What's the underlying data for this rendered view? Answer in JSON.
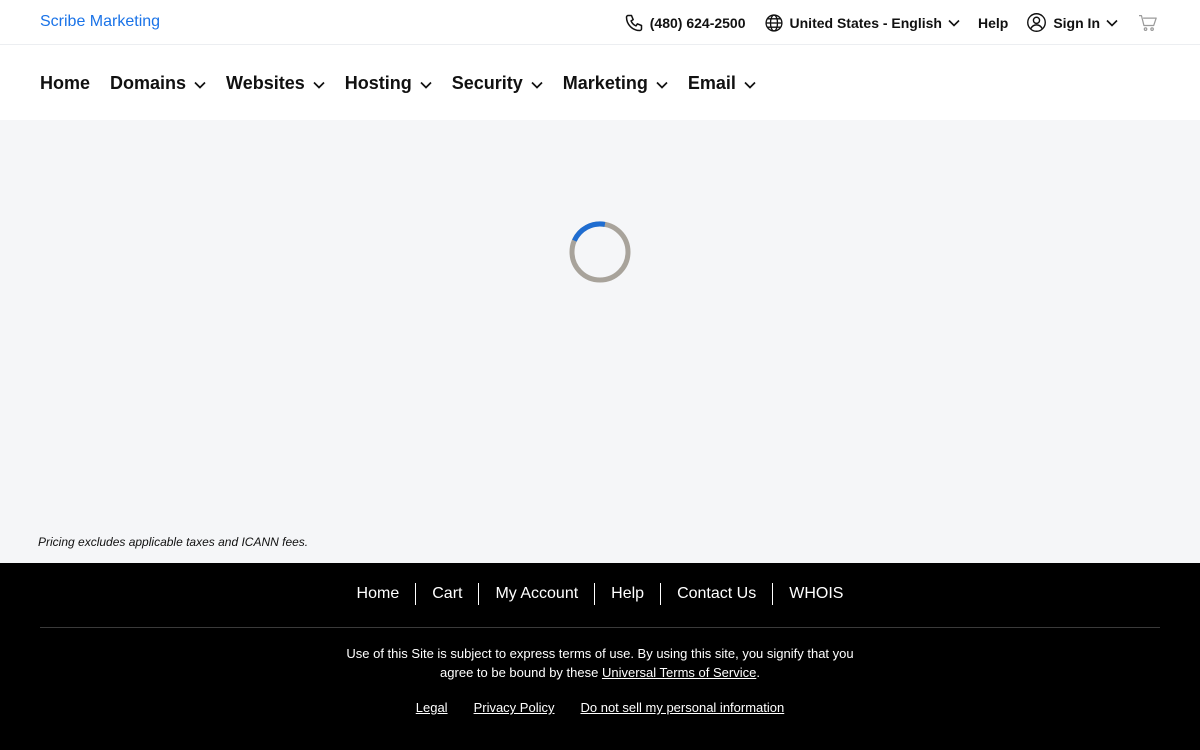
{
  "header": {
    "brand": "Scribe Marketing",
    "phone": "(480) 624-2500",
    "locale": "United States - English",
    "help": "Help",
    "sign_in": "Sign In",
    "icons": [
      "phone-icon",
      "globe-icon",
      "user-circle-icon",
      "cart-icon",
      "chevron-down-icon"
    ]
  },
  "nav": {
    "items": [
      {
        "label": "Home",
        "dropdown": false
      },
      {
        "label": "Domains",
        "dropdown": true
      },
      {
        "label": "Websites",
        "dropdown": true
      },
      {
        "label": "Hosting",
        "dropdown": true
      },
      {
        "label": "Security",
        "dropdown": true
      },
      {
        "label": "Marketing",
        "dropdown": true
      },
      {
        "label": "Email",
        "dropdown": true
      }
    ]
  },
  "main": {
    "disclaimer": "Pricing excludes applicable taxes and ICANN fees."
  },
  "footer": {
    "links": [
      "Home",
      "Cart",
      "My Account",
      "Help",
      "Contact Us",
      "WHOIS"
    ],
    "terms_before": "Use of this Site is subject to express terms of use. By using this site, you signify that you agree to be bound by these ",
    "terms_link": "Universal Terms of Service",
    "terms_after": ".",
    "legal_links": [
      "Legal",
      "Privacy Policy",
      "Do not sell my personal information"
    ]
  },
  "colors": {
    "brand_link": "#1a73e8",
    "spinner_active": "#1f6dd1",
    "spinner_track": "#a8a39b",
    "footer_bg": "#000000",
    "page_bg": "#f5f6f8"
  }
}
